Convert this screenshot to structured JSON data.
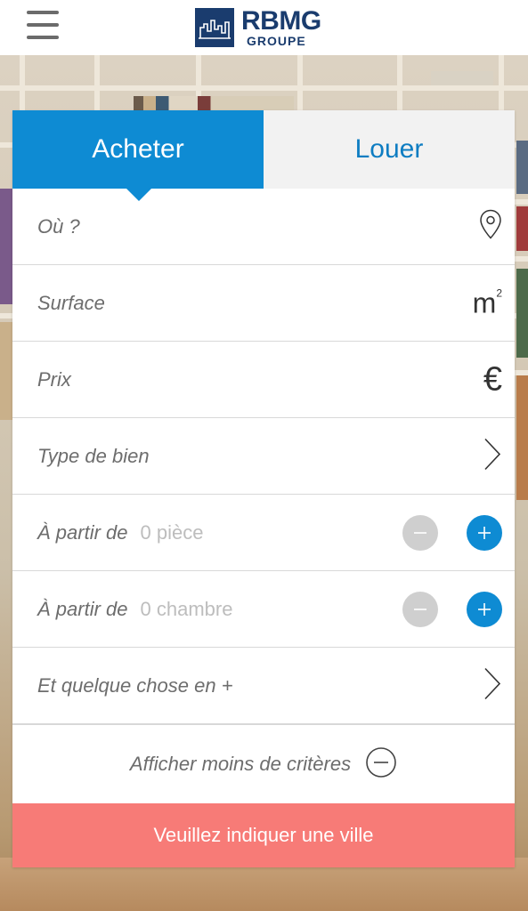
{
  "brand": {
    "title": "RBMG",
    "subtitle": "GROUPE",
    "color": "#1a3c6e"
  },
  "tabs": [
    {
      "label": "Acheter",
      "active": true
    },
    {
      "label": "Louer",
      "active": false
    }
  ],
  "fields": {
    "location": {
      "label": "Où ?",
      "icon": "map-pin-icon"
    },
    "surface": {
      "label": "Surface",
      "icon": "square-meter-icon",
      "unit": "m",
      "sup": "2"
    },
    "price": {
      "label": "Prix",
      "icon": "euro-icon",
      "symbol": "€"
    },
    "property_type": {
      "label": "Type de bien",
      "icon": "chevron-right-icon"
    },
    "rooms": {
      "label": "À partir de",
      "value": "0 pièce"
    },
    "bedrooms": {
      "label": "À partir de",
      "value": "0 chambre"
    },
    "extras": {
      "label": "Et quelque chose en +",
      "icon": "chevron-right-icon"
    }
  },
  "less_criteria": {
    "label": "Afficher moins de critères",
    "icon": "minus-circle-icon"
  },
  "cta": {
    "label": "Veuillez indiquer une ville"
  },
  "colors": {
    "accent": "#0e8bd3",
    "cta": "#f77b77",
    "disabled": "#cfcfcf"
  }
}
